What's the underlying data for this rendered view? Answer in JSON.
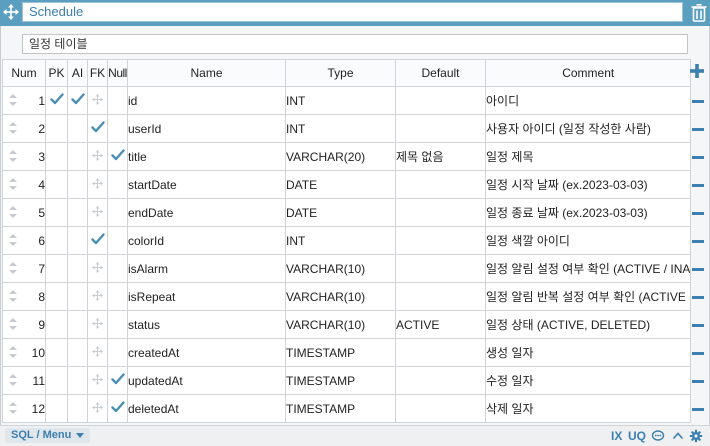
{
  "table": {
    "name": "Schedule",
    "comment": "일정 테이블"
  },
  "columns_header": {
    "num": "Num",
    "pk": "PK",
    "ai": "AI",
    "fk": "FK",
    "null": "Null",
    "name": "Name",
    "type": "Type",
    "default": "Default",
    "comment": "Comment"
  },
  "rows": [
    {
      "num": "1",
      "pk": true,
      "ai": true,
      "fk": false,
      "null": false,
      "name": "id",
      "type": "INT",
      "default": "",
      "comment": "아이디"
    },
    {
      "num": "2",
      "pk": false,
      "ai": false,
      "fk": true,
      "null": false,
      "name": "userId",
      "type": "INT",
      "default": "",
      "comment": "사용자 아이디 (일정 작성한 사람)"
    },
    {
      "num": "3",
      "pk": false,
      "ai": false,
      "fk": false,
      "null": true,
      "name": "title",
      "type": "VARCHAR(20)",
      "default": "제목 없음",
      "comment": "일정 제목"
    },
    {
      "num": "4",
      "pk": false,
      "ai": false,
      "fk": false,
      "null": false,
      "name": "startDate",
      "type": "DATE",
      "default": "",
      "comment": "일정 시작 날짜 (ex.2023-03-03)"
    },
    {
      "num": "5",
      "pk": false,
      "ai": false,
      "fk": false,
      "null": false,
      "name": "endDate",
      "type": "DATE",
      "default": "",
      "comment": "일정 종료 날짜 (ex.2023-03-03)"
    },
    {
      "num": "6",
      "pk": false,
      "ai": false,
      "fk": true,
      "null": false,
      "name": "colorId",
      "type": "INT",
      "default": "",
      "comment": "일정 색깔 아이디"
    },
    {
      "num": "7",
      "pk": false,
      "ai": false,
      "fk": false,
      "null": false,
      "name": "isAlarm",
      "type": "VARCHAR(10)",
      "default": "",
      "comment": "일정 알림 설정 여부 확인 (ACTIVE / INA"
    },
    {
      "num": "8",
      "pk": false,
      "ai": false,
      "fk": false,
      "null": false,
      "name": "isRepeat",
      "type": "VARCHAR(10)",
      "default": "",
      "comment": "일정 알림 반복 설정 여부 확인 (ACTIVE"
    },
    {
      "num": "9",
      "pk": false,
      "ai": false,
      "fk": false,
      "null": false,
      "name": "status",
      "type": "VARCHAR(10)",
      "default": "ACTIVE",
      "comment": "일정 상태 (ACTIVE, DELETED)"
    },
    {
      "num": "10",
      "pk": false,
      "ai": false,
      "fk": false,
      "null": false,
      "name": "createdAt",
      "type": "TIMESTAMP",
      "default": "",
      "comment": "생성 일자"
    },
    {
      "num": "11",
      "pk": false,
      "ai": false,
      "fk": false,
      "null": true,
      "name": "updatedAt",
      "type": "TIMESTAMP",
      "default": "",
      "comment": "수정 일자"
    },
    {
      "num": "12",
      "pk": false,
      "ai": false,
      "fk": false,
      "null": true,
      "name": "deletedAt",
      "type": "TIMESTAMP",
      "default": "",
      "comment": "삭제 일자"
    }
  ],
  "footer": {
    "sql_menu": "SQL / Menu",
    "ix": "IX",
    "uq": "UQ"
  },
  "icons": {
    "move": "move-icon",
    "trash": "trash-icon",
    "add": "plus-icon",
    "remove": "minus-icon",
    "check": "check-icon",
    "drag": "drag-handle-icon",
    "comment": "comment-icon",
    "collapse": "chevron-up-icon",
    "settings": "gear-icon"
  },
  "colors": {
    "title_bar": "#5a9fc0",
    "accent": "#3d7fae",
    "check": "#4a8fb3"
  }
}
